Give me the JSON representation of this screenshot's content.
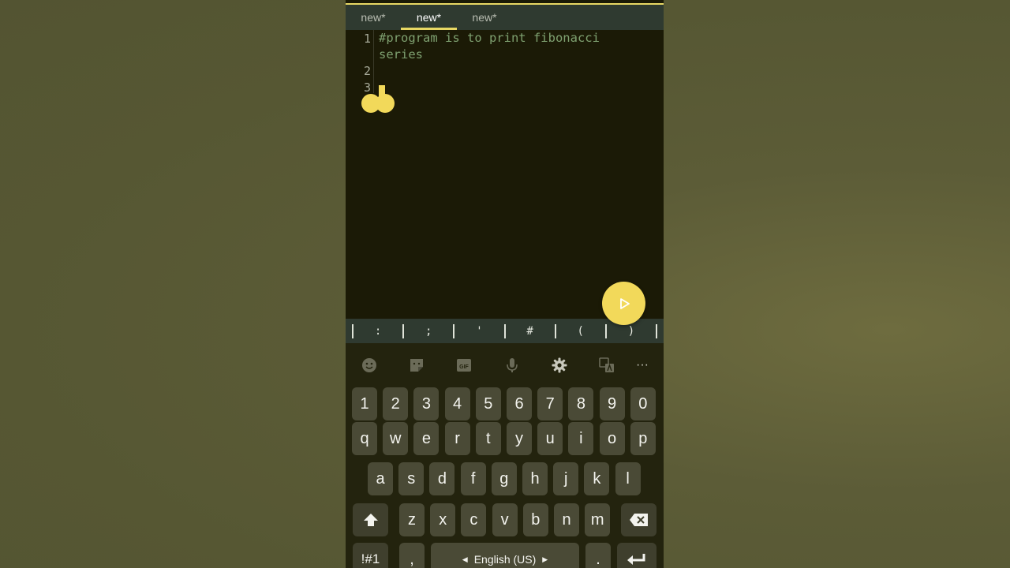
{
  "tabs": [
    {
      "label": "new*",
      "active": false
    },
    {
      "label": "new*",
      "active": true
    },
    {
      "label": "new*",
      "active": false
    }
  ],
  "editor": {
    "lines": [
      {
        "number": "1",
        "text_lines": [
          "#program is to print fibonacci",
          "series"
        ]
      },
      {
        "number": "2",
        "text_lines": [
          ""
        ]
      },
      {
        "number": "3",
        "text_lines": [
          ""
        ]
      }
    ]
  },
  "run_button": {
    "icon": "play-icon"
  },
  "symbol_bar": [
    ":",
    ";",
    "'",
    "#",
    "(",
    ")"
  ],
  "keyboard": {
    "toolbar": [
      "emoji-icon",
      "sticker-icon",
      "gif-icon",
      "mic-icon",
      "settings-icon",
      "translate-icon",
      "more-icon"
    ],
    "gif_label": "GIF",
    "more_label": "···",
    "number_row": [
      "1",
      "2",
      "3",
      "4",
      "5",
      "6",
      "7",
      "8",
      "9",
      "0"
    ],
    "row1": [
      "q",
      "w",
      "e",
      "r",
      "t",
      "y",
      "u",
      "i",
      "o",
      "p"
    ],
    "row2": [
      "a",
      "s",
      "d",
      "f",
      "g",
      "h",
      "j",
      "k",
      "l"
    ],
    "row3": [
      "z",
      "x",
      "c",
      "v",
      "b",
      "n",
      "m"
    ],
    "symbols_key": "!#1",
    "comma_key": ",",
    "space_label": "English (US)",
    "period_key": "."
  },
  "colors": {
    "accent": "#f2d95a",
    "editor_bg": "#1b1a06",
    "comment_text": "#7ea070",
    "tab_bar": "#2f3a30"
  }
}
